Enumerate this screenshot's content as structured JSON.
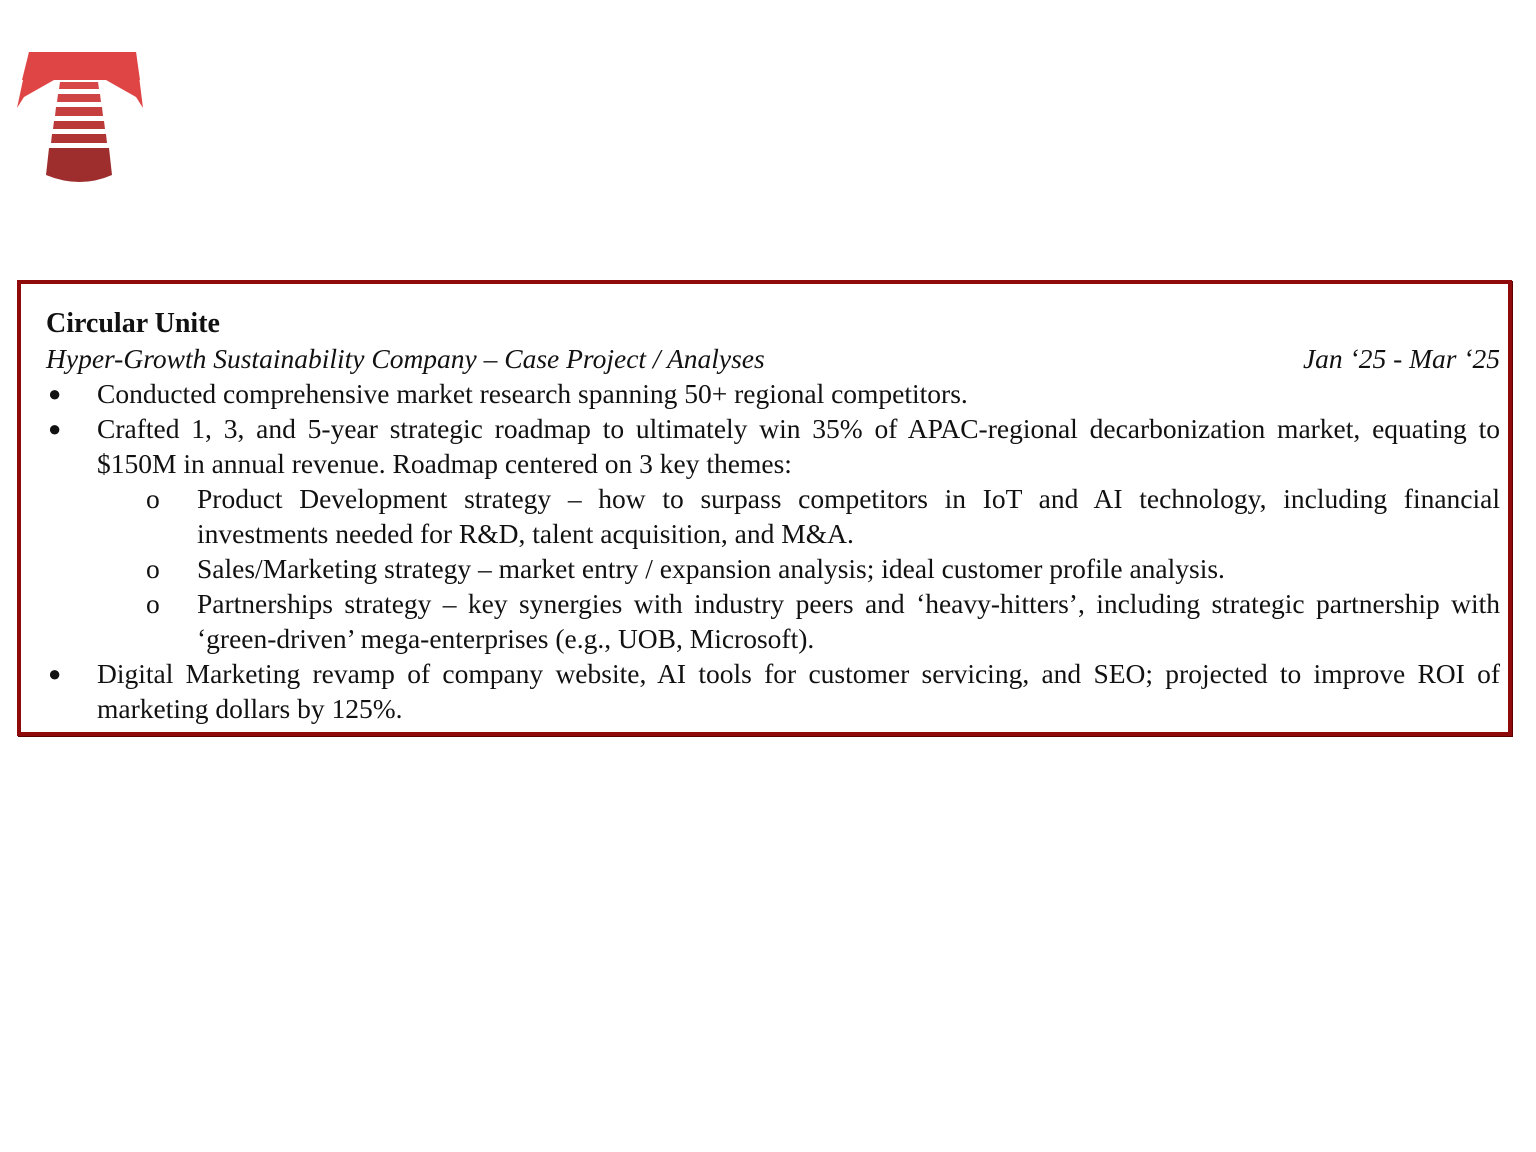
{
  "logo": {
    "icon": "stepped-t-logo-icon",
    "colors": {
      "top": "#e04040",
      "bottom": "#9b2a2a"
    }
  },
  "entry": {
    "company": "Circular Unite",
    "role": "Hyper-Growth Sustainability Company – Case Project / Analyses",
    "dates": "Jan ‘25 - Mar ‘25",
    "bullets": [
      {
        "marker": "●",
        "text": "Conducted comprehensive market research spanning 50+ regional competitors."
      },
      {
        "marker": "●",
        "text": "Crafted 1, 3, and 5-year strategic roadmap to ultimately win 35% of APAC-regional decarbonization market, equating to $150M in annual revenue. Roadmap centered on 3 key themes:",
        "sub": [
          {
            "marker": "o",
            "text": "Product Development strategy – how to surpass competitors in IoT and AI technology, including financial investments needed for R&D, talent acquisition, and M&A."
          },
          {
            "marker": "o",
            "text": "Sales/Marketing strategy – market entry / expansion analysis; ideal customer profile analysis."
          },
          {
            "marker": "o",
            "text": "Partnerships strategy – key synergies with industry peers and ‘heavy-hitters’, including strategic partnership with ‘green-driven’ mega-enterprises (e.g., UOB, Microsoft)."
          }
        ]
      },
      {
        "marker": "●",
        "text": "Digital Marketing revamp of company website, AI tools for customer servicing, and SEO; projected to improve ROI of marketing dollars by 125%."
      }
    ]
  },
  "colors": {
    "border": "#8f0b0b",
    "text": "#111111"
  }
}
